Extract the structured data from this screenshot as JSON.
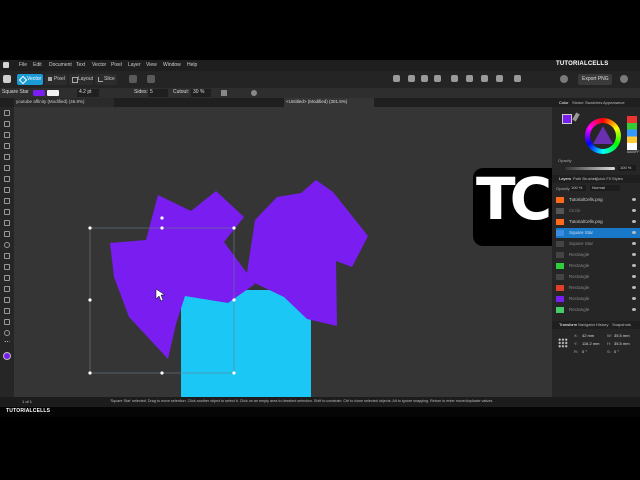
{
  "menu": [
    "File",
    "Edit",
    "Document",
    "Text",
    "Vector",
    "Pixel",
    "Layer",
    "View",
    "Window",
    "Help"
  ],
  "brand": "TUTORIALCELLS",
  "personas": {
    "vector": "Vector",
    "pixel": "Pixel",
    "layout": "Layout",
    "slice": "Slice"
  },
  "export_label": "Export PNG",
  "context": {
    "shape_name": "Square Star",
    "stroke_width": "4.2 pt",
    "sides_label": "Sides:",
    "sides_value": "5",
    "cutout_label": "Cutout:",
    "cutout_value": "30 %"
  },
  "tabs": [
    "youtube affinity (Modified) (46.8%)",
    "<Untitled> (Modified) (301.5%)"
  ],
  "right_tabs": {
    "color": [
      "Color",
      "Stroke",
      "Swatches",
      "Appearance"
    ],
    "layers": [
      "Layers",
      "Path Brushes",
      "Quick FX",
      "Styles"
    ],
    "transform": [
      "Transform",
      "Navigator",
      "History",
      "Snapshots"
    ]
  },
  "color": {
    "hex": "8A00FF",
    "opacity_label": "Opacity",
    "opacity_value": "100 %",
    "accent": "#7a1df0"
  },
  "layers_opacity": {
    "label": "Opacity:",
    "value": "100 %",
    "blend": "Normal"
  },
  "layers": [
    "TutorialCells.png",
    "Circle",
    "TutorialCells.png",
    "Square Star",
    "Square Star",
    "Rectangle",
    "Rectangle",
    "Rectangle",
    "Rectangle",
    "Rectangle",
    "Rectangle"
  ],
  "transform": {
    "x": "42 mm",
    "y": "116.2 mm",
    "w": "35.5 mm",
    "h": "35.5 mm",
    "r": "0 °",
    "s": "0 °"
  },
  "page_indicator": "1 of 1",
  "status": "'Square Star' selected. Drag to move selection. Click another object to select it. Click on an empty area to deselect selection. Shift to constrain. Ctrl to clone selected objects. Alt to ignore snapping. Return to enter move/duplicate values.",
  "logo_text": "TC",
  "colors": {
    "purple": "#7a1df0",
    "cyan": "#1bc7f5",
    "orange": "#ff6a1a"
  }
}
